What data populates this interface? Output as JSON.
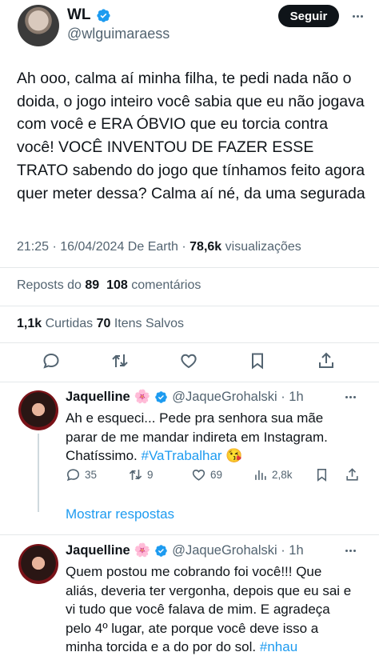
{
  "author": {
    "name": "WL",
    "handle": "@wlguimaraess",
    "follow_label": "Seguir"
  },
  "tweet": {
    "text": "Ah ooo,  calma aí minha filha, te pedi nada não o doida, o jogo inteiro você sabia que eu não jogava com você e ERA ÓBVIO que eu torcia contra você! VOCÊ INVENTOU DE FAZER ESSE TRATO sabendo do jogo que tínhamos feito agora quer meter dessa? Calma aí né, da uma segurada",
    "time": "21:25 · 16/04/2024",
    "source": " De Earth · ",
    "views_count": "78,6k",
    "views_label": " visualizações"
  },
  "stats": {
    "reposts_label": "Reposts do ",
    "reposts_count": "89",
    "comments_count": "108",
    "comments_label": " comentários",
    "likes_count": "1,1k",
    "likes_label": " Curtidas ",
    "saves_count": "70",
    "saves_label": " Itens Salvos"
  },
  "replies": [
    {
      "name": "Jaquelline",
      "emoji": "🌸",
      "handle": "@JaqueGrohalski · 1h",
      "text_lines": [
        "Ah e esqueci... Pede pra senhora sua mãe",
        "parar de me mandar indireta em Instagram."
      ],
      "text_end": "Chatíssimo. ",
      "hashtag": "#VaTrabalhar",
      "end_emoji": "😘",
      "reply_count": "35",
      "repost_count": "9",
      "like_count": "69",
      "view_count": "2,8k"
    },
    {
      "name": "Jaquelline",
      "emoji": "🌸",
      "handle": "@JaqueGrohalski · 1h",
      "text_lines": [
        "Quem postou me cobrando foi você!!! Que",
        "aliás, deveria ter vergonha, depois que eu sai e",
        "vi tudo que você falava de mim. E agradeça",
        "pelo 4º lugar, ate porque você deve isso a"
      ],
      "text_end": "minha torcida e a do por do sol. ",
      "hashtag": "#nhau"
    }
  ],
  "show_replies_label": "Mostrar respostas",
  "colors": {
    "accent": "#1d9bf0",
    "text": "#0f1419",
    "secondary": "#536471"
  }
}
